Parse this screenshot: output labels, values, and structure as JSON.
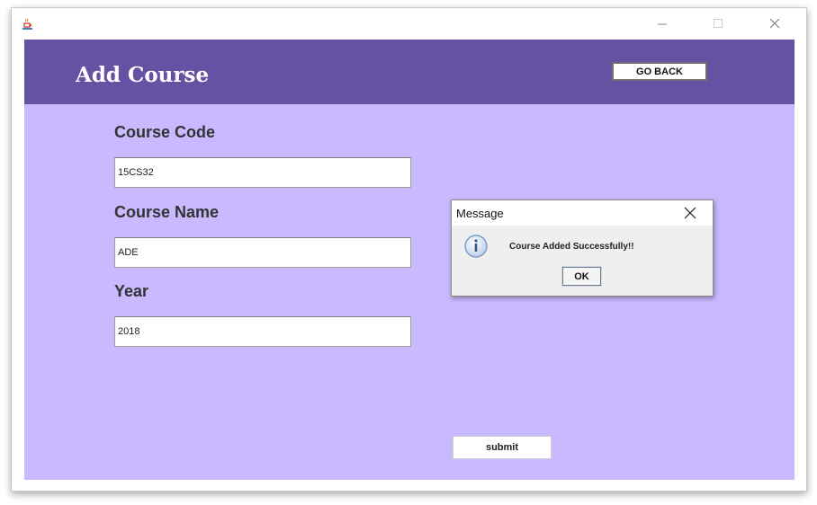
{
  "window": {
    "icon": "java-coffee-cup-icon",
    "controls": [
      "minimize-icon",
      "maximize-icon",
      "close-icon"
    ]
  },
  "header": {
    "title": "Add Course",
    "go_back_label": "GO BACK",
    "background": "#6652a3"
  },
  "form": {
    "background": "#c9b9fe",
    "course_code_label": "Course Code",
    "course_code_value": "15CS32",
    "course_name_label": "Course Name",
    "course_name_value": "ADE",
    "year_label": "Year",
    "year_value": "2018",
    "submit_label": "submit"
  },
  "dialog": {
    "title": "Message",
    "icon": "info-icon",
    "message": "Course Added Successfully!!",
    "ok_label": "OK"
  }
}
